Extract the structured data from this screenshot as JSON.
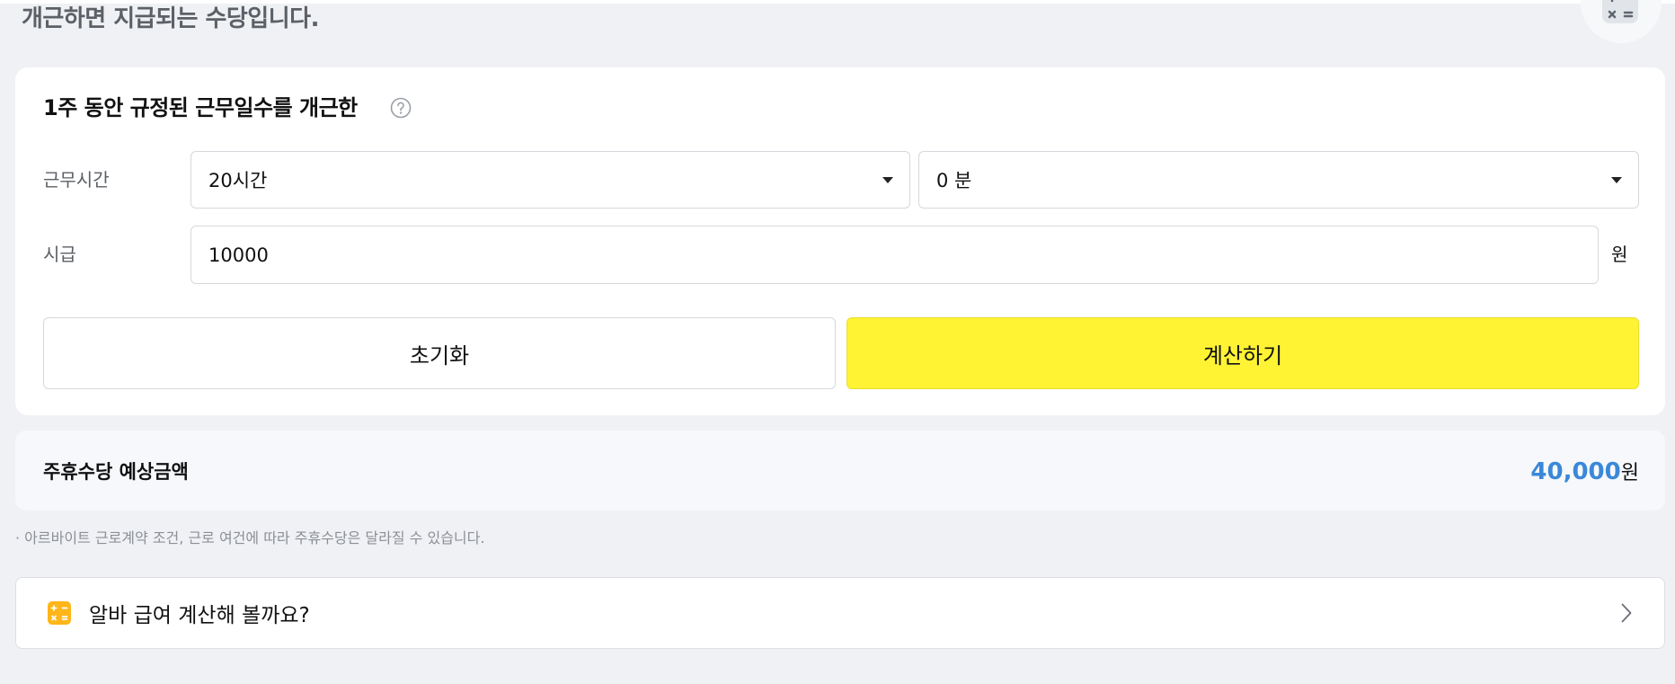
{
  "header": {
    "description": "개근하면 지급되는 수당입니다."
  },
  "form": {
    "title": "1주 동안 규정된 근무일수를 개근한",
    "work_time": {
      "label": "근무시간",
      "hours_value": "20시간",
      "minutes_value": "0 분"
    },
    "hourly_wage": {
      "label": "시급",
      "value": "10000",
      "unit": "원"
    },
    "reset_label": "초기화",
    "calculate_label": "계산하기"
  },
  "result": {
    "label": "주휴수당 예상금액",
    "amount": "40,000",
    "unit": "원"
  },
  "notice": "· 아르바이트 근로계약 조건, 근로 여건에 따라 주휴수당은 달라질 수 있습니다.",
  "promo": {
    "label": "알바 급여 계산해 볼까요?"
  },
  "icons": {
    "top_right": "calculator-icon",
    "help": "question-circle-icon",
    "dropdown": "caret-down-icon",
    "promo": "calculator-icon",
    "promo_arrow": "chevron-right-icon"
  },
  "theme": {
    "accent_yellow": "#fff334",
    "amount_blue": "#3b88d8"
  }
}
